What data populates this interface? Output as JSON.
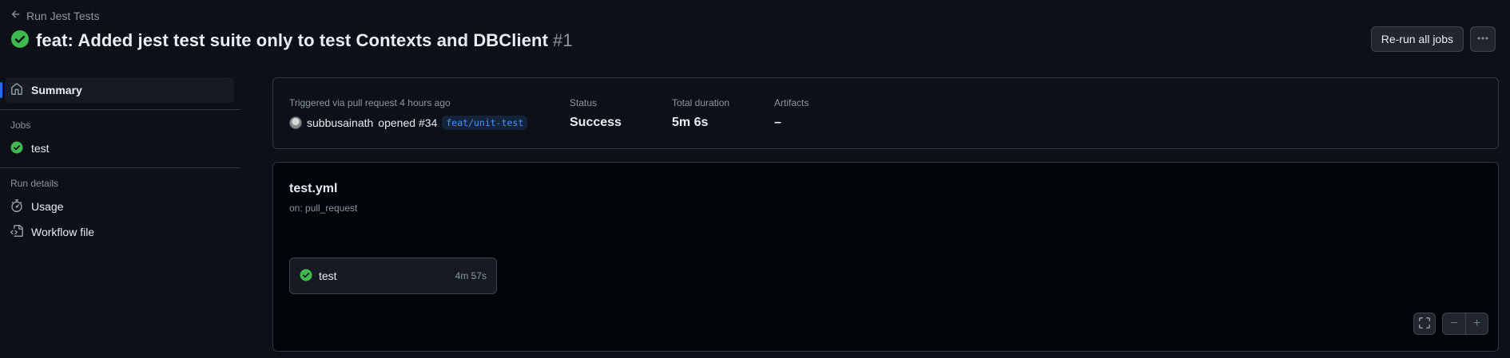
{
  "header": {
    "back_label": "Run Jest Tests",
    "title": "feat: Added jest test suite only to test Contexts and DBClient",
    "run_number": "#1",
    "rerun_label": "Re-run all jobs",
    "status_icon": "check-circle-fill-icon",
    "more_icon": "kebab-horizontal-icon"
  },
  "sidebar": {
    "summary_label": "Summary",
    "jobs_heading": "Jobs",
    "jobs": [
      {
        "label": "test",
        "icon": "check-circle-fill-icon"
      }
    ],
    "run_details_heading": "Run details",
    "run_details": [
      {
        "label": "Usage",
        "icon": "stopwatch-icon"
      },
      {
        "label": "Workflow file",
        "icon": "file-code-icon"
      }
    ]
  },
  "summary": {
    "trigger_text": "Triggered via pull request 4 hours ago",
    "user": "subbusainath",
    "action": "opened",
    "pr_number": "#34",
    "branch": "feat/unit-test",
    "status_label": "Status",
    "status_value": "Success",
    "duration_label": "Total duration",
    "duration_value": "5m 6s",
    "artifacts_label": "Artifacts",
    "artifacts_value": "–"
  },
  "workflow": {
    "file": "test.yml",
    "trigger": "on: pull_request",
    "jobs": [
      {
        "name": "test",
        "duration": "4m 57s",
        "status": "success"
      }
    ],
    "zoom_out_label": "−",
    "zoom_in_label": "+"
  },
  "colors": {
    "background": "#0d1117",
    "success": "#3fb950",
    "accent": "#1f6feb",
    "branch": "#4493f8"
  }
}
